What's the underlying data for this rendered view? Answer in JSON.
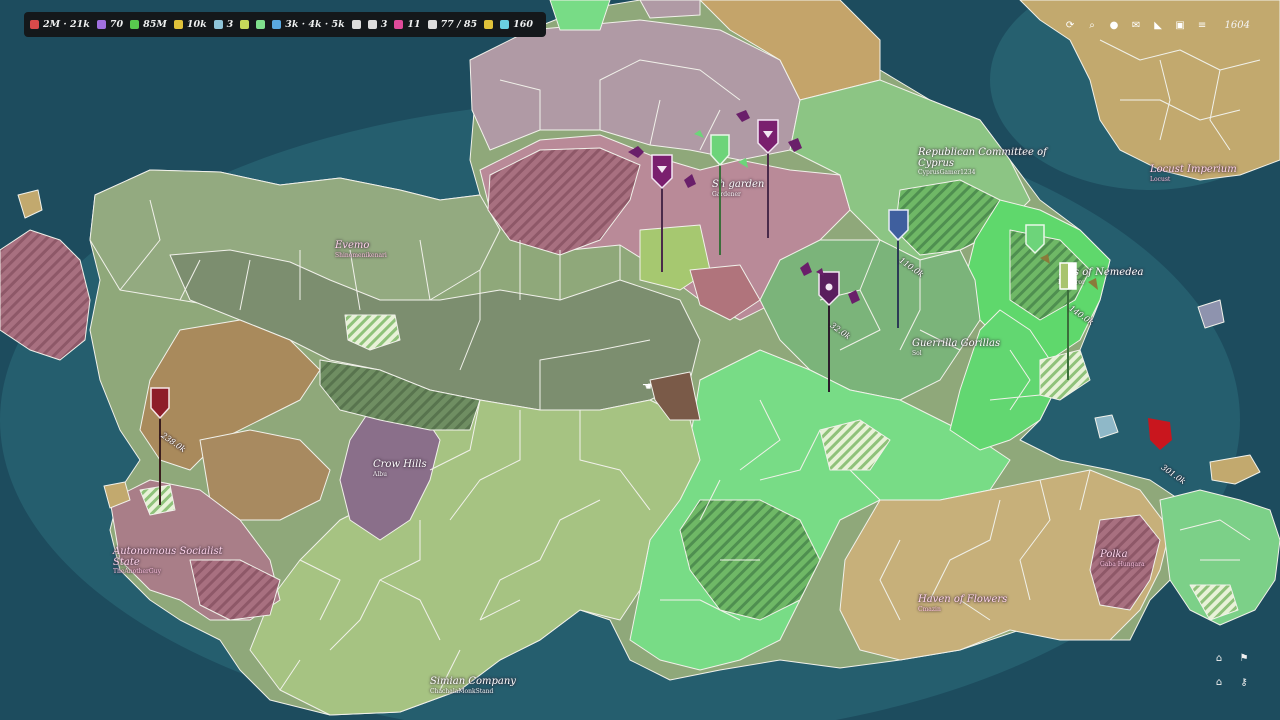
{
  "colors": {
    "sea": "#1c4a5c",
    "sea_shallow": "#3f8f98",
    "land_sage": "#8fa87a",
    "land_lime": "#a4c47e",
    "land_bright_green": "#7fe08c",
    "land_pink": "#b98a98",
    "land_brown": "#a88a5a",
    "land_tan": "#c8b078",
    "land_violet": "#8a6f8a",
    "border": "#f2f2ee"
  },
  "resources": [
    {
      "icon": "heart-shield-icon",
      "color": "#d94a4a",
      "value": "2M · 21k"
    },
    {
      "icon": "flame-icon",
      "color": "#a070e0",
      "value": "70"
    },
    {
      "icon": "food-icon",
      "color": "#58c94e",
      "value": "85M"
    },
    {
      "icon": "gold-icon",
      "color": "#e0c23a",
      "value": "10k"
    },
    {
      "icon": "building-icon",
      "color": "#8fc5d9",
      "value": "3"
    },
    {
      "icon": "badge-icon",
      "color": "#c6d85a",
      "value": ""
    },
    {
      "icon": "chat-bubble-icon",
      "color": "#7fe08c",
      "value": ""
    },
    {
      "icon": "pin-icon",
      "color": "#5aa8e0",
      "value": "3k · 4k · 5k"
    },
    {
      "icon": "compass-icon",
      "color": "#dddddd",
      "value": ""
    },
    {
      "icon": "scroll-icon",
      "color": "#dddddd",
      "value": "3"
    },
    {
      "icon": "flag-icon",
      "color": "#e04a9a",
      "value": "11"
    },
    {
      "icon": "network-icon",
      "color": "#dddddd",
      "value": "77 / 85"
    },
    {
      "icon": "trophy-icon",
      "color": "#e0c23a",
      "value": ""
    },
    {
      "icon": "diamond-icon",
      "color": "#6ad0e0",
      "value": "160"
    }
  ],
  "toolbar": {
    "icons": [
      "refresh-icon",
      "search-icon",
      "circle-icon",
      "mail-icon",
      "chart-icon",
      "gift-icon",
      "menu-icon"
    ],
    "glyphs": [
      "⟳",
      "⌕",
      "●",
      "✉",
      "◣",
      "▣",
      "≡"
    ],
    "year": "1604"
  },
  "nations": [
    {
      "name": "Evemo",
      "leader": "Shinomenikenari",
      "pink": true
    },
    {
      "name": "Republican Committee of",
      "name2": "Cyprus",
      "leader": "CyprusGamer1234",
      "pink": false
    },
    {
      "name": "Sh garden",
      "leader": "Gardener",
      "pink": false
    },
    {
      "name": "…es of Nemedea",
      "leader": "Emperor",
      "pink": false
    },
    {
      "name": "Guerrilla Gorillas",
      "leader": "Sol",
      "pink": false
    },
    {
      "name": "Locust Imperium",
      "leader": "Locust",
      "pink": true
    },
    {
      "name": "Crow Hills",
      "leader": "Albu",
      "pink": false
    },
    {
      "name": "Autonomous Socialist",
      "name2": "State",
      "leader": "TheAnotherGuy",
      "pink": true
    },
    {
      "name": "Polka",
      "leader": "Gaba Hungara",
      "pink": true
    },
    {
      "name": "Haven of Flowers",
      "leader": "Cmazin",
      "pink": true
    },
    {
      "name": "Simian Company",
      "leader": "ChachalaMonkStand",
      "pink": false
    }
  ],
  "troops": [
    "140.0k",
    "110.0k",
    "32.0k",
    "238.0k",
    "301.0k"
  ],
  "corner_icons": [
    "home-icon",
    "flag-icon",
    "bank-icon",
    "key-icon"
  ],
  "corner_glyphs": [
    "⌂",
    "⚑",
    "⌂",
    "⚷"
  ]
}
